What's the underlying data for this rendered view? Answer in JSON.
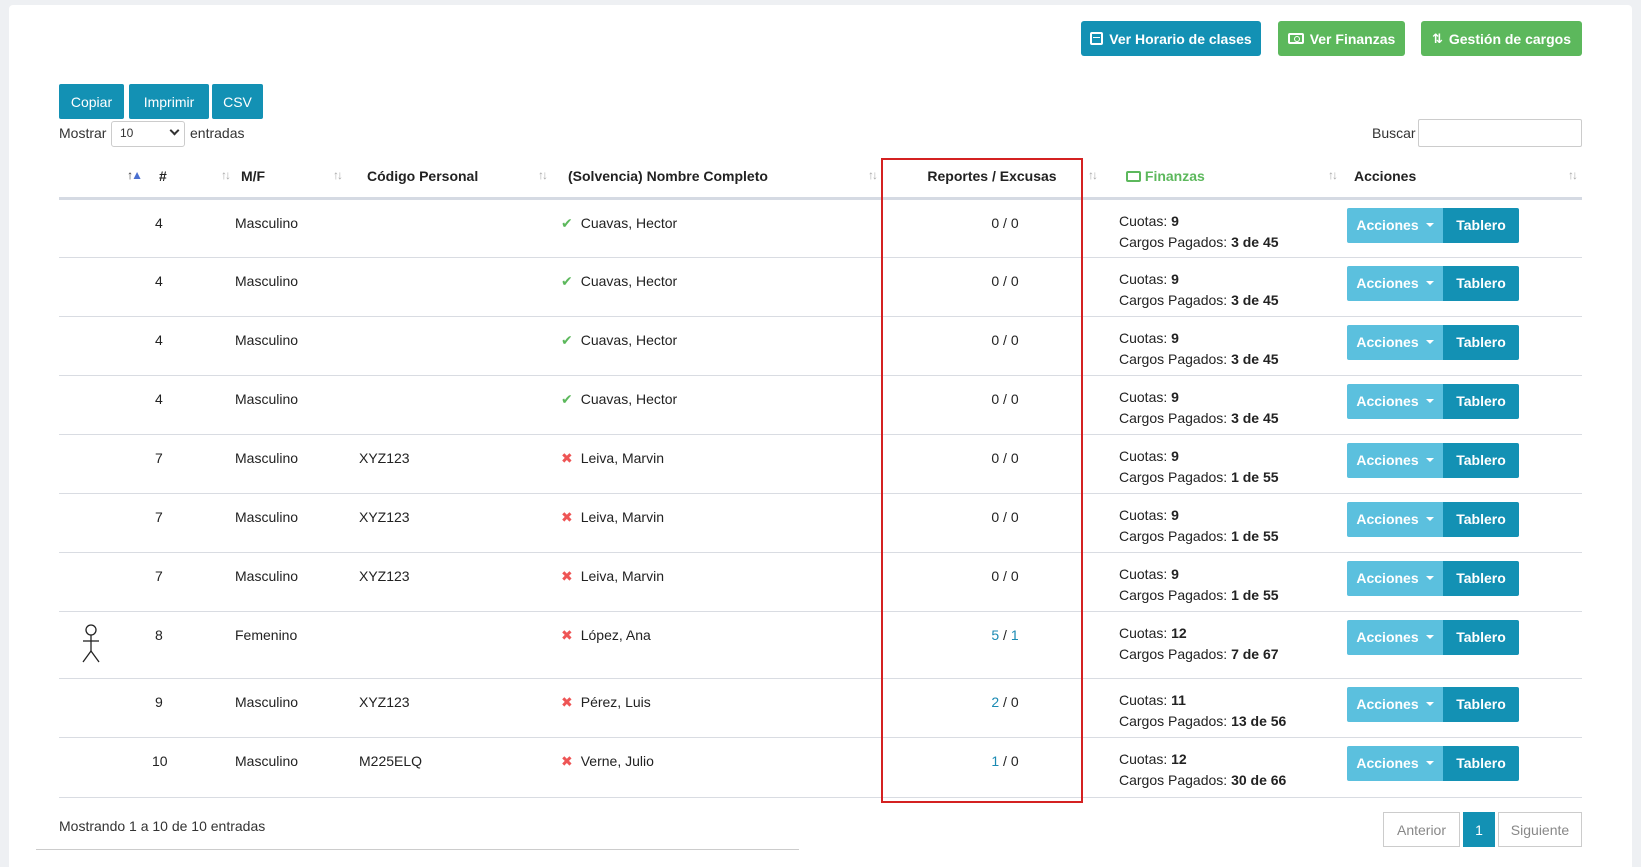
{
  "top_buttons": {
    "horario": "Ver Horario de clases",
    "finanzas": "Ver Finanzas",
    "cargos": "Gestión de cargos"
  },
  "export": {
    "copy": "Copiar",
    "print": "Imprimir",
    "csv": "CSV"
  },
  "length": {
    "prefix": "Mostrar",
    "value": "10",
    "suffix": "entradas"
  },
  "search_label": "Buscar",
  "headers": {
    "num": "#",
    "sex": "M/F",
    "code": "Código Personal",
    "name": "(Solvencia) Nombre Completo",
    "reports": "Reportes / Excusas",
    "finances": "Finanzas",
    "actions": "Acciones"
  },
  "row_labels": {
    "cuotas": "Cuotas:",
    "cargos": "Cargos Pagados:",
    "acciones": "Acciones",
    "tablero": "Tablero"
  },
  "rows": [
    {
      "num": "4",
      "sex": "Masculino",
      "code": "",
      "solvent": true,
      "name": "Cuavas, Hector",
      "rep": "0",
      "exc": "0",
      "cuotas": "9",
      "cargos": "3 de 45"
    },
    {
      "num": "4",
      "sex": "Masculino",
      "code": "",
      "solvent": true,
      "name": "Cuavas, Hector",
      "rep": "0",
      "exc": "0",
      "cuotas": "9",
      "cargos": "3 de 45"
    },
    {
      "num": "4",
      "sex": "Masculino",
      "code": "",
      "solvent": true,
      "name": "Cuavas, Hector",
      "rep": "0",
      "exc": "0",
      "cuotas": "9",
      "cargos": "3 de 45"
    },
    {
      "num": "4",
      "sex": "Masculino",
      "code": "",
      "solvent": true,
      "name": "Cuavas, Hector",
      "rep": "0",
      "exc": "0",
      "cuotas": "9",
      "cargos": "3 de 45"
    },
    {
      "num": "7",
      "sex": "Masculino",
      "code": "XYZ123",
      "solvent": false,
      "name": "Leiva, Marvin",
      "rep": "0",
      "exc": "0",
      "cuotas": "9",
      "cargos": "1 de 55"
    },
    {
      "num": "7",
      "sex": "Masculino",
      "code": "XYZ123",
      "solvent": false,
      "name": "Leiva, Marvin",
      "rep": "0",
      "exc": "0",
      "cuotas": "9",
      "cargos": "1 de 55"
    },
    {
      "num": "7",
      "sex": "Masculino",
      "code": "XYZ123",
      "solvent": false,
      "name": "Leiva, Marvin",
      "rep": "0",
      "exc": "0",
      "cuotas": "9",
      "cargos": "1 de 55"
    },
    {
      "num": "8",
      "sex": "Femenino",
      "code": "",
      "solvent": false,
      "name": "López, Ana",
      "rep": "5",
      "exc": "1",
      "cuotas": "12",
      "cargos": "7 de 67",
      "avatar": true
    },
    {
      "num": "9",
      "sex": "Masculino",
      "code": "XYZ123",
      "solvent": false,
      "name": "Pérez, Luis",
      "rep": "2",
      "exc": "0",
      "cuotas": "11",
      "cargos": "13 de 56"
    },
    {
      "num": "10",
      "sex": "Masculino",
      "code": "M225ELQ",
      "solvent": false,
      "name": "Verne, Julio",
      "rep": "1",
      "exc": "0",
      "cuotas": "12",
      "cargos": "30 de 66"
    }
  ],
  "info": "Mostrando 1 a 10 de 10 entradas",
  "pagination": {
    "prev": "Anterior",
    "page": "1",
    "next": "Siguiente"
  },
  "colors": {
    "primary": "#1391b4",
    "success": "#5cb85c",
    "info": "#5bc0de",
    "highlight": "#d42121"
  }
}
